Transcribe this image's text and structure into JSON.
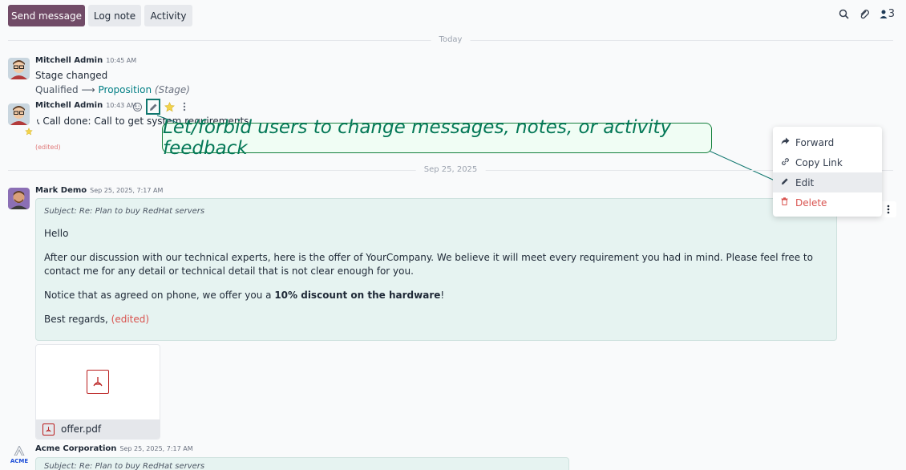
{
  "toolbar": {
    "send_message": "Send message",
    "log_note": "Log note",
    "activity": "Activity",
    "followers_count": "3"
  },
  "separators": {
    "today": "Today",
    "sep25": "Sep 25, 2025"
  },
  "messages": [
    {
      "author": "Mitchell Admin",
      "time": "10:45 AM",
      "body": "Stage changed",
      "stage_old": "Qualified",
      "stage_arrow": "⟶",
      "stage_new": "Proposition",
      "stage_label": "(Stage)"
    },
    {
      "author": "Mitchell Admin",
      "time": "10:43 AM",
      "body": "Call done: Call to get system requirements",
      "edited": "(edited)"
    },
    {
      "author": "Mark Demo",
      "time": "Sep 25, 2025, 7:17 AM",
      "subject": "Subject: Re: Plan to buy RedHat servers",
      "greeting": "Hello",
      "para1": "After our discussion with our technical experts, here is the offer of YourCompany. We believe it will meet every requirement you had in mind. Please feel free to contact me for any detail or technical detail that is not clear enough for you.",
      "para2_prefix": "Notice that as agreed on phone, we offer you a ",
      "para2_bold": "10% discount on the hardware",
      "para2_suffix": "!",
      "closing": "Best regards,",
      "edited": "(edited)",
      "attachment": "offer.pdf"
    },
    {
      "author": "Acme Corporation",
      "time": "Sep 25, 2025, 7:17 AM",
      "subject": "Subject: Re: Plan to buy RedHat servers",
      "logo_text": "ACME"
    }
  ],
  "callout": {
    "text": "Let/forbid users to change messages, notes, or activity feedback"
  },
  "menu": {
    "forward": "Forward",
    "copy_link": "Copy Link",
    "edit": "Edit",
    "delete": "Delete"
  },
  "colors": {
    "primary": "#714B67",
    "accent": "#017e84",
    "danger": "#d9534f",
    "callout": "#047857"
  }
}
